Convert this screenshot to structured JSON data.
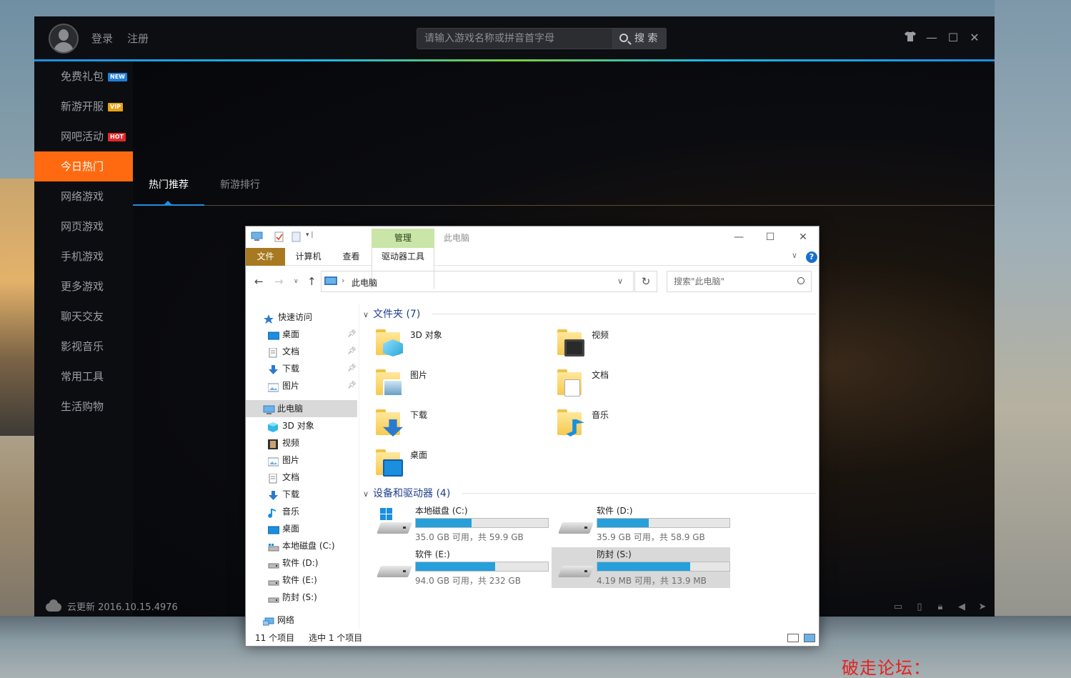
{
  "launcher": {
    "login": "登录",
    "register": "注册",
    "search_placeholder": "请输入游戏名称或拼音首字母",
    "search_button": "搜 索",
    "nav": [
      {
        "label": "免费礼包",
        "badge": "NEW",
        "badge_type": "new"
      },
      {
        "label": "新游开服",
        "badge": "VIP",
        "badge_type": "vip"
      },
      {
        "label": "网吧活动",
        "badge": "HOT",
        "badge_type": "hot"
      },
      {
        "label": "今日热门",
        "badge": "",
        "active": true
      },
      {
        "label": "网络游戏",
        "badge": ""
      },
      {
        "label": "网页游戏",
        "badge": ""
      },
      {
        "label": "手机游戏",
        "badge": ""
      },
      {
        "label": "更多游戏",
        "badge": ""
      },
      {
        "label": "聊天交友",
        "badge": ""
      },
      {
        "label": "影视音乐",
        "badge": ""
      },
      {
        "label": "常用工具",
        "badge": ""
      },
      {
        "label": "生活购物",
        "badge": ""
      }
    ],
    "tabs": [
      "热门推荐",
      "新游排行"
    ],
    "update_text": "云更新 2016.10.15.4976",
    "colors": {
      "accent": "#ff6a10",
      "tab_active": "#1f8fe0"
    }
  },
  "explorer": {
    "manage_tab": "管理",
    "window_title": "此电脑",
    "ribbon_tabs": [
      "文件",
      "计算机",
      "查看",
      "驱动器工具"
    ],
    "address_path": "此电脑",
    "search_placeholder": "搜索\"此电脑\"",
    "tree": {
      "quick_access": "快速访问",
      "quick_items": [
        "桌面",
        "文档",
        "下载",
        "图片"
      ],
      "this_pc": "此电脑",
      "pc_items": [
        "3D 对象",
        "视频",
        "图片",
        "文档",
        "下载",
        "音乐",
        "桌面",
        "本地磁盘 (C:)",
        "软件 (D:)",
        "软件 (E:)",
        "防封 (S:)"
      ],
      "network": "网络"
    },
    "folders_header": "文件夹 (7)",
    "folders": [
      "3D 对象",
      "视频",
      "图片",
      "文档",
      "下载",
      "音乐",
      "桌面"
    ],
    "drives_header": "设备和驱动器 (4)",
    "drives": [
      {
        "name": "本地磁盘 (C:)",
        "info": "35.0 GB 可用，共 59.9 GB",
        "used_fraction": 0.42
      },
      {
        "name": "软件 (D:)",
        "info": "35.9 GB 可用，共 58.9 GB",
        "used_fraction": 0.39
      },
      {
        "name": "软件 (E:)",
        "info": "94.0 GB 可用，共 232 GB",
        "used_fraction": 0.6
      },
      {
        "name": "防封 (S:)",
        "info": "4.19 MB 可用，共 13.9 MB",
        "used_fraction": 0.7
      }
    ],
    "status_count": "11 个项目",
    "status_selected": "选中 1 个项目"
  },
  "watermark": "破走论坛：www.pozou.com"
}
